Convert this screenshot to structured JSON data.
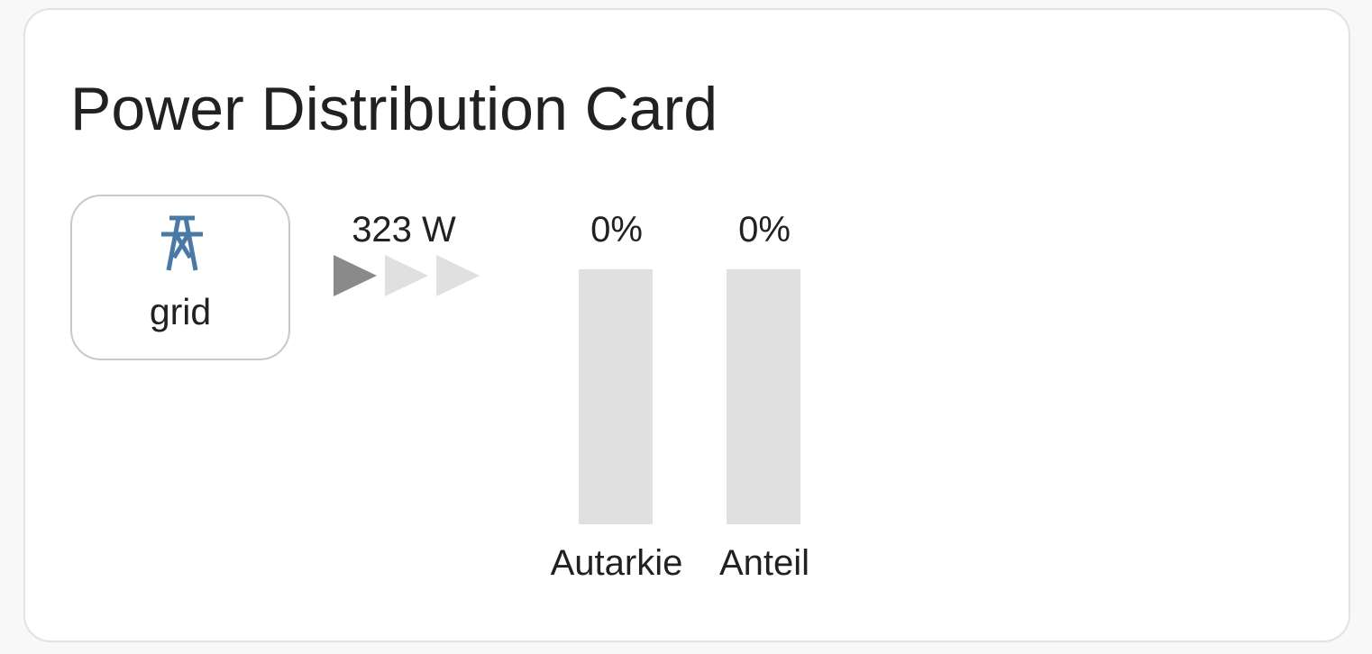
{
  "card": {
    "title": "Power Distribution Card"
  },
  "grid": {
    "label": "grid",
    "icon": "transmission-tower-icon",
    "icon_color": "#4a79a5",
    "power_value": "323 W"
  },
  "flow": {
    "direction": "right",
    "active_arrow_color": "#8a8a8a",
    "inactive_arrow_color": "#e0e0e0"
  },
  "bars": [
    {
      "name": "Autarkie",
      "value_text": "0%",
      "percent": 0
    },
    {
      "name": "Anteil",
      "value_text": "0%",
      "percent": 0
    }
  ]
}
